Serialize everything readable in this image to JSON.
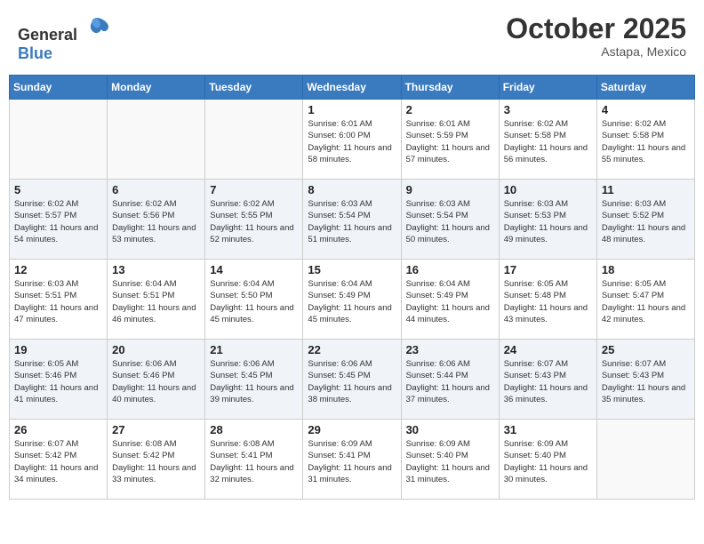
{
  "logo": {
    "general": "General",
    "blue": "Blue"
  },
  "header": {
    "month": "October 2025",
    "location": "Astapa, Mexico"
  },
  "weekdays": [
    "Sunday",
    "Monday",
    "Tuesday",
    "Wednesday",
    "Thursday",
    "Friday",
    "Saturday"
  ],
  "weeks": [
    {
      "shaded": false,
      "days": [
        {
          "num": "",
          "info": ""
        },
        {
          "num": "",
          "info": ""
        },
        {
          "num": "",
          "info": ""
        },
        {
          "num": "1",
          "info": "Sunrise: 6:01 AM\nSunset: 6:00 PM\nDaylight: 11 hours\nand 58 minutes."
        },
        {
          "num": "2",
          "info": "Sunrise: 6:01 AM\nSunset: 5:59 PM\nDaylight: 11 hours\nand 57 minutes."
        },
        {
          "num": "3",
          "info": "Sunrise: 6:02 AM\nSunset: 5:58 PM\nDaylight: 11 hours\nand 56 minutes."
        },
        {
          "num": "4",
          "info": "Sunrise: 6:02 AM\nSunset: 5:58 PM\nDaylight: 11 hours\nand 55 minutes."
        }
      ]
    },
    {
      "shaded": true,
      "days": [
        {
          "num": "5",
          "info": "Sunrise: 6:02 AM\nSunset: 5:57 PM\nDaylight: 11 hours\nand 54 minutes."
        },
        {
          "num": "6",
          "info": "Sunrise: 6:02 AM\nSunset: 5:56 PM\nDaylight: 11 hours\nand 53 minutes."
        },
        {
          "num": "7",
          "info": "Sunrise: 6:02 AM\nSunset: 5:55 PM\nDaylight: 11 hours\nand 52 minutes."
        },
        {
          "num": "8",
          "info": "Sunrise: 6:03 AM\nSunset: 5:54 PM\nDaylight: 11 hours\nand 51 minutes."
        },
        {
          "num": "9",
          "info": "Sunrise: 6:03 AM\nSunset: 5:54 PM\nDaylight: 11 hours\nand 50 minutes."
        },
        {
          "num": "10",
          "info": "Sunrise: 6:03 AM\nSunset: 5:53 PM\nDaylight: 11 hours\nand 49 minutes."
        },
        {
          "num": "11",
          "info": "Sunrise: 6:03 AM\nSunset: 5:52 PM\nDaylight: 11 hours\nand 48 minutes."
        }
      ]
    },
    {
      "shaded": false,
      "days": [
        {
          "num": "12",
          "info": "Sunrise: 6:03 AM\nSunset: 5:51 PM\nDaylight: 11 hours\nand 47 minutes."
        },
        {
          "num": "13",
          "info": "Sunrise: 6:04 AM\nSunset: 5:51 PM\nDaylight: 11 hours\nand 46 minutes."
        },
        {
          "num": "14",
          "info": "Sunrise: 6:04 AM\nSunset: 5:50 PM\nDaylight: 11 hours\nand 45 minutes."
        },
        {
          "num": "15",
          "info": "Sunrise: 6:04 AM\nSunset: 5:49 PM\nDaylight: 11 hours\nand 45 minutes."
        },
        {
          "num": "16",
          "info": "Sunrise: 6:04 AM\nSunset: 5:49 PM\nDaylight: 11 hours\nand 44 minutes."
        },
        {
          "num": "17",
          "info": "Sunrise: 6:05 AM\nSunset: 5:48 PM\nDaylight: 11 hours\nand 43 minutes."
        },
        {
          "num": "18",
          "info": "Sunrise: 6:05 AM\nSunset: 5:47 PM\nDaylight: 11 hours\nand 42 minutes."
        }
      ]
    },
    {
      "shaded": true,
      "days": [
        {
          "num": "19",
          "info": "Sunrise: 6:05 AM\nSunset: 5:46 PM\nDaylight: 11 hours\nand 41 minutes."
        },
        {
          "num": "20",
          "info": "Sunrise: 6:06 AM\nSunset: 5:46 PM\nDaylight: 11 hours\nand 40 minutes."
        },
        {
          "num": "21",
          "info": "Sunrise: 6:06 AM\nSunset: 5:45 PM\nDaylight: 11 hours\nand 39 minutes."
        },
        {
          "num": "22",
          "info": "Sunrise: 6:06 AM\nSunset: 5:45 PM\nDaylight: 11 hours\nand 38 minutes."
        },
        {
          "num": "23",
          "info": "Sunrise: 6:06 AM\nSunset: 5:44 PM\nDaylight: 11 hours\nand 37 minutes."
        },
        {
          "num": "24",
          "info": "Sunrise: 6:07 AM\nSunset: 5:43 PM\nDaylight: 11 hours\nand 36 minutes."
        },
        {
          "num": "25",
          "info": "Sunrise: 6:07 AM\nSunset: 5:43 PM\nDaylight: 11 hours\nand 35 minutes."
        }
      ]
    },
    {
      "shaded": false,
      "days": [
        {
          "num": "26",
          "info": "Sunrise: 6:07 AM\nSunset: 5:42 PM\nDaylight: 11 hours\nand 34 minutes."
        },
        {
          "num": "27",
          "info": "Sunrise: 6:08 AM\nSunset: 5:42 PM\nDaylight: 11 hours\nand 33 minutes."
        },
        {
          "num": "28",
          "info": "Sunrise: 6:08 AM\nSunset: 5:41 PM\nDaylight: 11 hours\nand 32 minutes."
        },
        {
          "num": "29",
          "info": "Sunrise: 6:09 AM\nSunset: 5:41 PM\nDaylight: 11 hours\nand 31 minutes."
        },
        {
          "num": "30",
          "info": "Sunrise: 6:09 AM\nSunset: 5:40 PM\nDaylight: 11 hours\nand 31 minutes."
        },
        {
          "num": "31",
          "info": "Sunrise: 6:09 AM\nSunset: 5:40 PM\nDaylight: 11 hours\nand 30 minutes."
        },
        {
          "num": "",
          "info": ""
        }
      ]
    }
  ]
}
